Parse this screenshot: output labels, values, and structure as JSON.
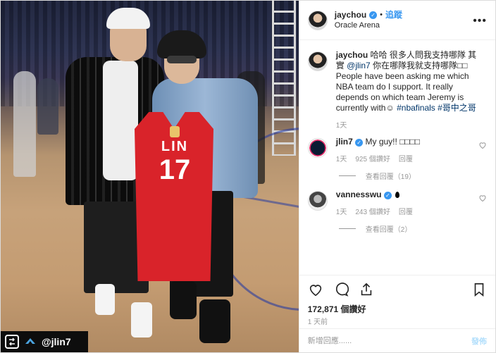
{
  "post": {
    "username": "jaychou",
    "follow_label": "追蹤",
    "location": "Oracle Arena",
    "caption_text": "哈哈 很多人問我支持哪隊 其實",
    "caption_mention": "@jlin7",
    "caption_text2": "你在哪隊我就支持哪隊",
    "caption_text3": "People have been asking me which NBA team do I support. It really depends on which team Jeremy is currently with",
    "caption_tags": "#nbafinals #哥中之哥",
    "caption_time": "1天"
  },
  "photo": {
    "jersey_name": "LIN",
    "jersey_number": "17",
    "repost_user": "@jlin7",
    "repost_icon_letter": "?"
  },
  "comments": [
    {
      "username": "jlin7",
      "text": "My guy!! ",
      "time": "1天",
      "likes": "925 個讚好",
      "reply_label": "回覆",
      "view_replies": "查看回覆（19）"
    },
    {
      "username": "vannesswu",
      "text": "",
      "time": "1天",
      "likes": "243 個讚好",
      "reply_label": "回覆",
      "view_replies": "查看回覆（2）"
    }
  ],
  "stats": {
    "likes": "172,871 個讚好",
    "time_ago": "1 天前"
  },
  "comment_box": {
    "placeholder": "新增回應......",
    "post_label": "發佈"
  },
  "colors": {
    "link_blue": "#3897f0",
    "jersey_red": "#d9232a"
  }
}
